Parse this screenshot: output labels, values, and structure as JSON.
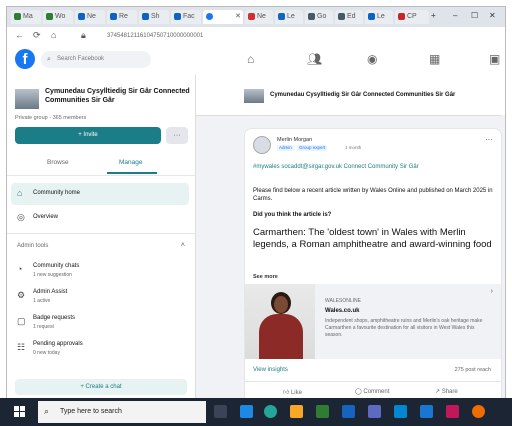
{
  "browser": {
    "tabs": [
      "Ma",
      "Wo",
      "Ne",
      "Re",
      "Sh",
      "Fac",
      "Ne",
      "Le",
      "Go",
      "Ed",
      "Le",
      "CP"
    ],
    "active_tab_label": "",
    "url": "37454812116104750710000000001"
  },
  "facebook": {
    "logo": "f",
    "search_placeholder": "Search Facebook"
  },
  "group": {
    "name": "Cymunedau Cysylltiedig Sir Gâr Connected Communities Sir Gâr",
    "meta": "Private group · 365 members",
    "invite_label": "+ Invite",
    "more_label": "···",
    "tabs": [
      "Browse",
      "Manage"
    ],
    "community_home": "Community home",
    "overview": "Overview",
    "section_header": "Admin tools",
    "tools": [
      {
        "title": "Community chats",
        "sub": "1 new suggestion"
      },
      {
        "title": "Admin Assist",
        "sub": "1 active"
      },
      {
        "title": "Badge requests",
        "sub": "1 request"
      },
      {
        "title": "Pending approvals",
        "sub": "0 new today"
      }
    ],
    "create_chat": "+ Create a chat"
  },
  "main_header": {
    "title": "Cymunedau Cysylltiedig Sir Gâr Connected Communities Sir Gâr"
  },
  "post": {
    "author": "Merlin Morgan",
    "badges": [
      "Admin",
      "Group expert"
    ],
    "time": "1 month",
    "line1": "#mywales socaddt@sirgar.gov.uk Connect Community Sir Gâr",
    "line2": "Please find below a recent article written by Wales Online and published on March 2025 in Carms.",
    "question": "Did you think the article is?",
    "headline": "Carmarthen: The 'oldest town' in Wales with Merlin legends, a Roman amphitheatre and award-winning food",
    "see_more": "See more",
    "preview_source": "WALESONLINE",
    "preview_title": "Wales.co.uk",
    "preview_desc": "Independent shops, amphitheatre ruins and Merlin's oak heritage make Carmarthen a favourite destination for all visitors in West Wales this season.",
    "insights": "View insights",
    "reach": "275 post reach",
    "actions": [
      "Like",
      "Comment",
      "Share"
    ]
  },
  "taskbar": {
    "search_placeholder": "Type here to search",
    "clock": ""
  },
  "colors": {
    "accent": "#1b7d87",
    "facebook_blue": "#1877f2",
    "taskbar": "#1c2533"
  }
}
